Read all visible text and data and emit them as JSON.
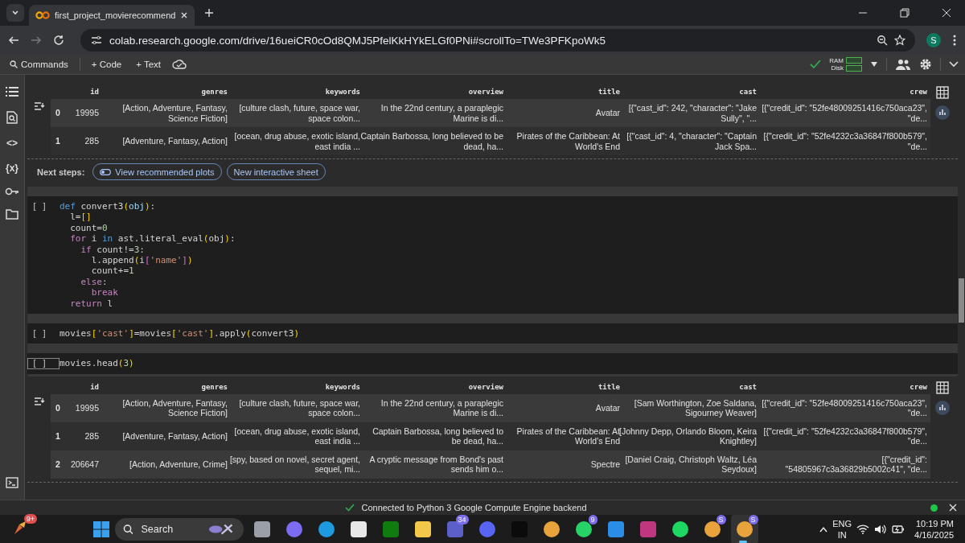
{
  "browser": {
    "tab_title": "first_project_movierecommend",
    "url": "colab.research.google.com/drive/16ueiCR0cOd8QMJ5PfelKkHYkELGf0PNi#scrollTo=TWe3PFKpoWk5",
    "profile_initial": "S"
  },
  "toolbar": {
    "commands": "Commands",
    "add_code": "+ Code",
    "add_text": "+ Text",
    "ram_label": "RAM",
    "disk_label": "Disk"
  },
  "sidebar": [
    {
      "kind": "toc"
    },
    {
      "kind": "search"
    },
    {
      "kind": "code",
      "glyph": "<>"
    },
    {
      "kind": "variables",
      "glyph": "{x}"
    },
    {
      "kind": "key"
    },
    {
      "kind": "folder"
    },
    {
      "kind": "terminal"
    }
  ],
  "cells": [
    {
      "kind": "table",
      "columns": [
        "id",
        "genres",
        "keywords",
        "overview",
        "title",
        "cast",
        "crew"
      ],
      "rows": [
        {
          "index": "0",
          "cells": [
            "19995",
            "[Action, Adventure, Fantasy,\nScience Fiction]",
            "[culture clash, future, space war,\nspace colon...",
            "In the 22nd century, a paraplegic\nMarine is di...",
            "Avatar",
            "[{\"cast_id\": 242, \"character\": \"Jake\nSully\", \"...",
            "[{\"credit_id\": \"52fe48009251416c750aca23\",\n\"de..."
          ]
        },
        {
          "index": "1",
          "cells": [
            "285",
            "[Adventure, Fantasy, Action]",
            "[ocean, drug abuse, exotic island,\neast india ...",
            "Captain Barbossa, long believed to be\ndead, ha...",
            "Pirates of the Caribbean: At\nWorld's End",
            "[{\"cast_id\": 4, \"character\": \"Captain\nJack Spa...",
            "[{\"credit_id\": \"52fe4232c3a36847f800b579\",\n\"de..."
          ]
        }
      ]
    },
    {
      "kind": "next_steps",
      "label": "Next steps:",
      "buttons": [
        {
          "label": "View recommended plots",
          "icon": true
        },
        {
          "label": "New interactive sheet",
          "icon": false
        }
      ]
    },
    {
      "kind": "code",
      "marker": "[ ]",
      "focused": false,
      "lines": [
        [
          {
            "t": "def",
            "kind": "def"
          },
          {
            "t": " convert3",
            "kind": "plain"
          },
          {
            "t": "(",
            "kind": "br"
          },
          {
            "t": "obj",
            "kind": "var"
          },
          {
            "t": ")",
            "kind": "br"
          },
          {
            "t": ":",
            "kind": "plain"
          }
        ],
        [
          {
            "t": "  l=",
            "kind": "plain"
          },
          {
            "t": "[]",
            "kind": "br"
          }
        ],
        [
          {
            "t": "  count=",
            "kind": "plain"
          },
          {
            "t": "0",
            "kind": "num"
          }
        ],
        [
          {
            "t": "  for",
            "kind": "kw"
          },
          {
            "t": " i ",
            "kind": "plain"
          },
          {
            "t": "in",
            "kind": "def"
          },
          {
            "t": " ast.literal_eval",
            "kind": "plain"
          },
          {
            "t": "(",
            "kind": "br"
          },
          {
            "t": "obj",
            "kind": "plain"
          },
          {
            "t": ")",
            "kind": "br"
          },
          {
            "t": ":",
            "kind": "plain"
          }
        ],
        [
          {
            "t": "    if",
            "kind": "kw"
          },
          {
            "t": " count!=",
            "kind": "plain"
          },
          {
            "t": "3",
            "kind": "num"
          },
          {
            "t": ":",
            "kind": "plain"
          }
        ],
        [
          {
            "t": "      l.append",
            "kind": "plain"
          },
          {
            "t": "(",
            "kind": "br"
          },
          {
            "t": "i",
            "kind": "plain"
          },
          {
            "t": "[",
            "kind": "br2"
          },
          {
            "t": "'name'",
            "kind": "str"
          },
          {
            "t": "]",
            "kind": "br2"
          },
          {
            "t": ")",
            "kind": "br"
          }
        ],
        [
          {
            "t": "      count+=",
            "kind": "plain"
          },
          {
            "t": "1",
            "kind": "num"
          }
        ],
        [
          {
            "t": "    else",
            "kind": "kw"
          },
          {
            "t": ":",
            "kind": "plain"
          }
        ],
        [
          {
            "t": "      break",
            "kind": "kw"
          }
        ],
        [
          {
            "t": "  return",
            "kind": "kw"
          },
          {
            "t": " l",
            "kind": "plain"
          }
        ]
      ]
    },
    {
      "kind": "code",
      "marker": "[ ]",
      "focused": false,
      "lines": [
        [
          {
            "t": "movies",
            "kind": "plain"
          },
          {
            "t": "[",
            "kind": "br"
          },
          {
            "t": "'cast'",
            "kind": "str"
          },
          {
            "t": "]",
            "kind": "br"
          },
          {
            "t": "=movies",
            "kind": "plain"
          },
          {
            "t": "[",
            "kind": "br"
          },
          {
            "t": "'cast'",
            "kind": "str"
          },
          {
            "t": "]",
            "kind": "br"
          },
          {
            "t": ".apply",
            "kind": "plain"
          },
          {
            "t": "(",
            "kind": "br"
          },
          {
            "t": "convert3",
            "kind": "plain"
          },
          {
            "t": ")",
            "kind": "br"
          }
        ]
      ]
    },
    {
      "kind": "code",
      "marker": "[ ]",
      "focused": true,
      "lines": [
        [
          {
            "t": "movies.head",
            "kind": "plain"
          },
          {
            "t": "(",
            "kind": "br"
          },
          {
            "t": "3",
            "kind": "num"
          },
          {
            "t": ")",
            "kind": "br"
          }
        ]
      ]
    },
    {
      "kind": "table",
      "columns": [
        "id",
        "genres",
        "keywords",
        "overview",
        "title",
        "cast",
        "crew"
      ],
      "rows": [
        {
          "index": "0",
          "cells": [
            "19995",
            "[Action, Adventure, Fantasy,\nScience Fiction]",
            "[culture clash, future, space war,\nspace colon...",
            "In the 22nd century, a paraplegic\nMarine is di...",
            "Avatar",
            "[Sam Worthington, Zoe Saldana,\nSigourney Weaver]",
            "[{\"credit_id\": \"52fe48009251416c750aca23\",\n\"de..."
          ]
        },
        {
          "index": "1",
          "cells": [
            "285",
            "[Adventure, Fantasy, Action]",
            "[ocean, drug abuse, exotic island,\neast india ...",
            "Captain Barbossa, long believed to\nbe dead, ha...",
            "Pirates of the Caribbean: At\nWorld's End",
            "[Johnny Depp, Orlando Bloom, Keira\nKnightley]",
            "[{\"credit_id\": \"52fe4232c3a36847f800b579\",\n\"de..."
          ]
        },
        {
          "index": "2",
          "cells": [
            "206647",
            "[Action, Adventure, Crime]",
            "[spy, based on novel, secret agent,\nsequel, mi...",
            "A cryptic message from Bond's past\nsends him o...",
            "Spectre",
            "[Daniel Craig, Christoph Waltz, Léa\nSeydoux]",
            "[{\"credit_id\":\n\"54805967c3a36829b5002c41\", \"de..."
          ]
        }
      ]
    }
  ],
  "status_bar": {
    "message": "Connected to Python 3 Google Compute Engine backend"
  },
  "taskbar": {
    "widget_badge": "9+",
    "search": {
      "placeholder": "Search"
    },
    "apps": [
      {
        "kind": "stack"
      },
      {
        "kind": "copilot"
      },
      {
        "kind": "edge"
      },
      {
        "kind": "store"
      },
      {
        "kind": "xbox"
      },
      {
        "kind": "folder"
      },
      {
        "kind": "teams",
        "badge": "34"
      },
      {
        "kind": "discord"
      },
      {
        "kind": "dark"
      },
      {
        "kind": "chrome"
      },
      {
        "kind": "whatsapp",
        "badge": "9"
      },
      {
        "kind": "vscode"
      },
      {
        "kind": "pink"
      },
      {
        "kind": "spotify"
      },
      {
        "kind": "chrome",
        "badge": "S"
      },
      {
        "kind": "chrome",
        "badge": "S",
        "active": true
      }
    ],
    "language": "ENG",
    "region": "IN",
    "time": "10:19 PM",
    "date": "4/16/2025"
  }
}
